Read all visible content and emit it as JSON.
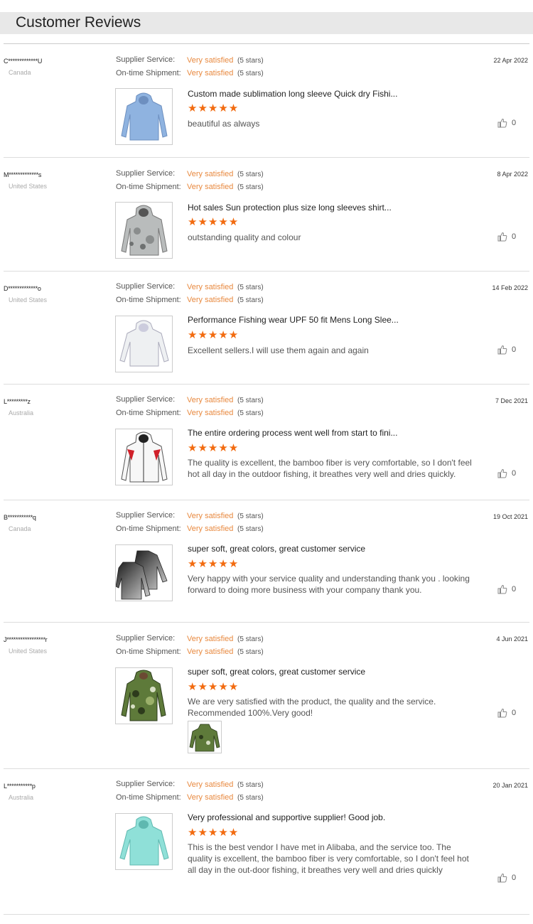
{
  "page": {
    "title": "Customer Reviews"
  },
  "labels": {
    "supplier": "Supplier Service:",
    "shipment": "On-time Shipment:"
  },
  "reviews": [
    {
      "user": "C*************U",
      "country": "Canada",
      "date": "22  Apr 2022",
      "supplier_rating": "Very satisfied",
      "supplier_stars": "(5 stars)",
      "shipment_rating": "Very satisfied",
      "shipment_stars": "(5 stars)",
      "product": "Custom made sublimation long sleeve Quick dry Fishi...",
      "stars": "★★★★★",
      "comment": "beautiful as always",
      "likes": "0",
      "shirt": "light-blue-hoodie"
    },
    {
      "user": "M*************s",
      "country": "United States",
      "date": "8  Apr 2022",
      "supplier_rating": "Very satisfied",
      "supplier_stars": "(5 stars)",
      "shipment_rating": "Very satisfied",
      "shipment_stars": "(5 stars)",
      "product": "Hot sales Sun protection plus size long sleeves shirt...",
      "stars": "★★★★★",
      "comment": "outstanding quality and colour",
      "likes": "0",
      "shirt": "grey-camo-hoodie"
    },
    {
      "user": "D*************o",
      "country": "United States",
      "date": "14  Feb 2022",
      "supplier_rating": "Very satisfied",
      "supplier_stars": "(5 stars)",
      "shipment_rating": "Very satisfied",
      "shipment_stars": "(5 stars)",
      "product": "Performance Fishing wear UPF 50 fit Mens Long Slee...",
      "stars": "★★★★★",
      "comment": "Excellent sellers.I will use them again and again",
      "likes": "0",
      "shirt": "white-hoodie"
    },
    {
      "user": "L*********z",
      "country": "Australia",
      "date": "7  Dec 2021",
      "supplier_rating": "Very satisfied",
      "supplier_stars": "(5 stars)",
      "shipment_rating": "Very satisfied",
      "shipment_stars": "(5 stars)",
      "product": "The entire ordering process went well from start to fini...",
      "stars": "★★★★★",
      "comment": "The quality is excellent, the bamboo fiber is very comfortable, so I don't feel hot all day in the outdoor fishing, it breathes very well and dries quickly.",
      "likes": "0",
      "shirt": "white-red-jacket"
    },
    {
      "user": "B***********q",
      "country": "Canada",
      "date": "19  Oct 2021",
      "supplier_rating": "Very satisfied",
      "supplier_stars": "(5 stars)",
      "shipment_rating": "Very satisfied",
      "shipment_stars": "(5 stars)",
      "product": "super soft, great colors, great customer service",
      "stars": "★★★★★",
      "comment": "Very happy with your service quality and understanding thank you . looking forward to doing more business with your company thank you.",
      "likes": "0",
      "shirt": "black-gradient-shirts"
    },
    {
      "user": "J*****************r",
      "country": "United States",
      "date": "4  Jun 2021",
      "supplier_rating": "Very satisfied",
      "supplier_stars": "(5 stars)",
      "shipment_rating": "Very satisfied",
      "shipment_stars": "(5 stars)",
      "product": "super soft, great colors, great customer service",
      "stars": "★★★★★",
      "comment": "We are very satisfied with the product, the quality and the service. Recommended 100%.Very good!",
      "likes": "0",
      "shirt": "green-camo-shirt"
    },
    {
      "user": "L***********p",
      "country": "Australia",
      "date": "20  Jan 2021",
      "supplier_rating": "Very satisfied",
      "supplier_stars": "(5 stars)",
      "shipment_rating": "Very satisfied",
      "shipment_stars": "(5 stars)",
      "product": "Very professional and supportive supplier! Good job.",
      "stars": "★★★★★",
      "comment": "This is the best vendor I have met in Alibaba, and the service too. The quality is excellent, the bamboo fiber is very comfortable, so I don't feel hot all day in the out-door fishing, it breathes very well and dries quickly",
      "likes": "0",
      "shirt": "mint-hoodie"
    }
  ]
}
